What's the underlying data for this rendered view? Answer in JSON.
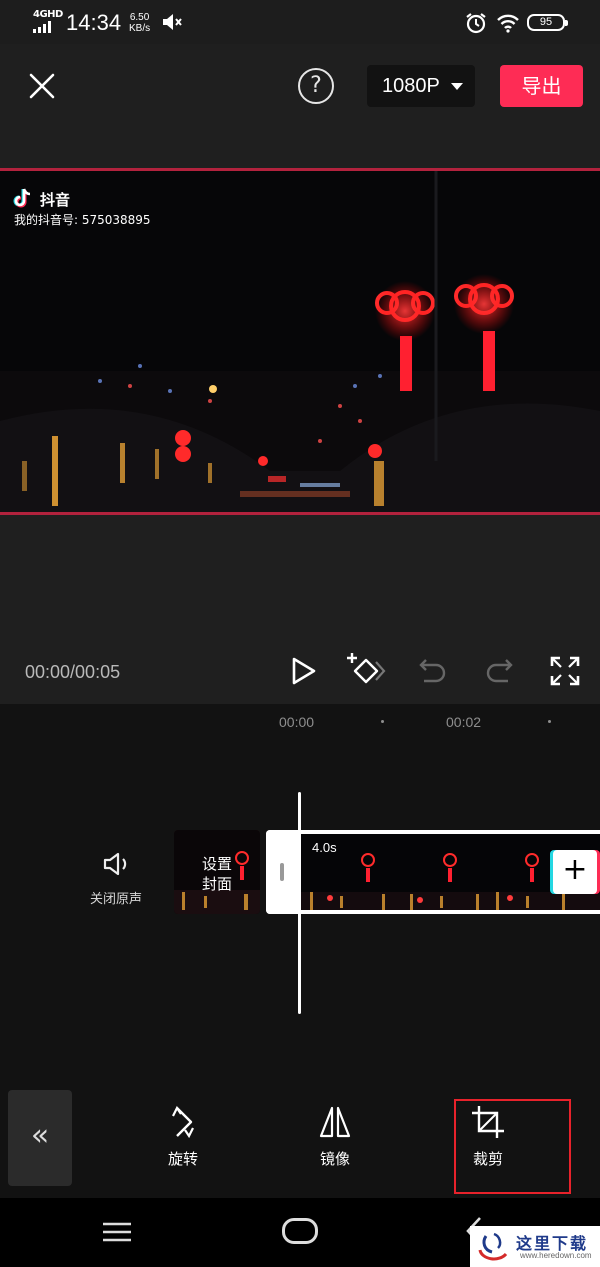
{
  "status_bar": {
    "network": "4GHD",
    "time": "14:34",
    "speed_value": "6.50",
    "speed_unit": "KB/s",
    "battery": "95",
    "icons": [
      "signal-icon",
      "mute-icon",
      "alarm-icon",
      "wifi-icon",
      "battery-icon"
    ]
  },
  "top_bar": {
    "resolution": "1080P",
    "export_label": "导出",
    "help_symbol": "?",
    "icons": [
      "close-icon",
      "help-icon",
      "caret-down-icon"
    ]
  },
  "video": {
    "tiktok_name": "抖音",
    "tiktok_id": "我的抖音号: 575038895"
  },
  "playback": {
    "time_display": "00:00/00:05",
    "icons": [
      "play-icon",
      "keyframe-icon",
      "undo-icon",
      "redo-icon",
      "fullscreen-icon"
    ]
  },
  "timeline": {
    "ruler": [
      "00:00",
      "00:02"
    ],
    "mute_label": "关闭原声",
    "cover_label_line1": "设置",
    "cover_label_line2": "封面",
    "clip_duration": "4.0s",
    "add_symbol": "+"
  },
  "toolbar": {
    "back_symbol": "«",
    "tools": [
      {
        "label": "旋转",
        "icon": "rotate-icon"
      },
      {
        "label": "镜像",
        "icon": "mirror-icon"
      },
      {
        "label": "裁剪",
        "icon": "crop-icon"
      }
    ],
    "selected_tool": "裁剪"
  },
  "watermark": {
    "title": "这里下载",
    "sub": "www.heredown.com"
  },
  "colors": {
    "accent": "#fe2c55",
    "highlight_box": "#e8222b",
    "background": "#1f1f1f",
    "panel": "#121212"
  }
}
